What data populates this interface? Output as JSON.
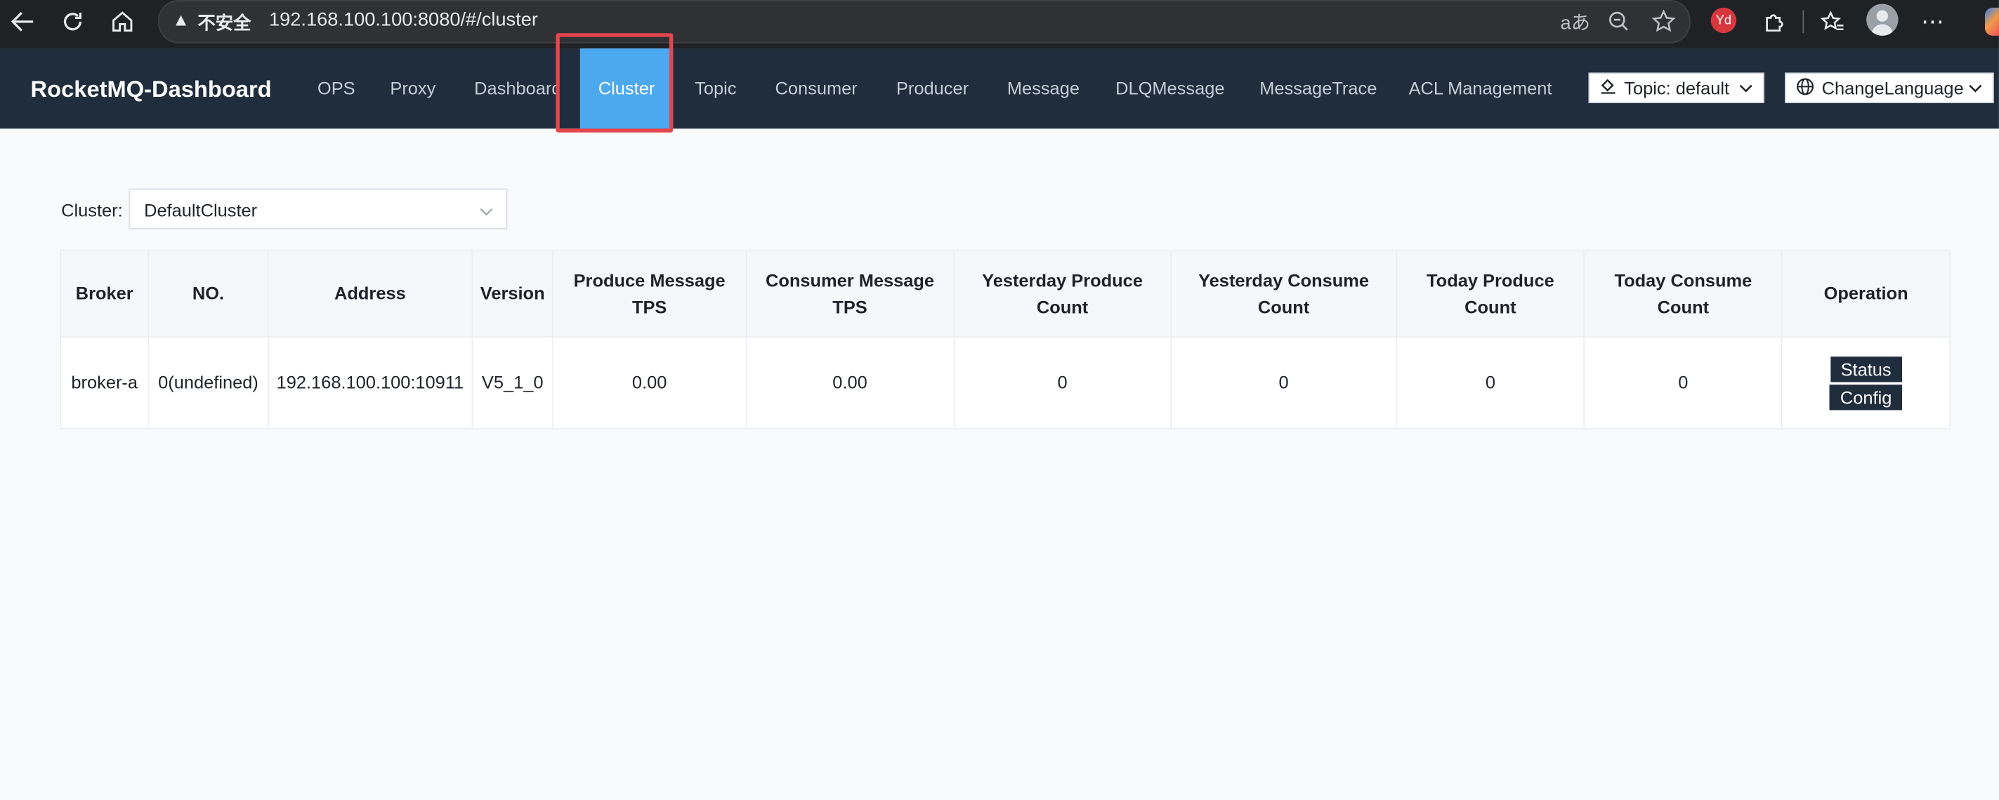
{
  "browser": {
    "security_label": "不安全",
    "url": "192.168.100.100:8080/#/cluster",
    "translate_glyph": "aあ",
    "extension_badge": "Yd"
  },
  "app": {
    "title": "RocketMQ-Dashboard",
    "nav": [
      {
        "label": "OPS",
        "active": false
      },
      {
        "label": "Proxy",
        "active": false
      },
      {
        "label": "Dashboard",
        "active": false
      },
      {
        "label": "Cluster",
        "active": true
      },
      {
        "label": "Topic",
        "active": false
      },
      {
        "label": "Consumer",
        "active": false
      },
      {
        "label": "Producer",
        "active": false
      },
      {
        "label": "Message",
        "active": false
      },
      {
        "label": "DLQMessage",
        "active": false
      },
      {
        "label": "MessageTrace",
        "active": false
      },
      {
        "label": "ACL Management",
        "active": false
      }
    ],
    "theme_select": "Topic: default",
    "language_select": "ChangeLanguage",
    "colors": {
      "header_bg": "#1f2d3d",
      "active_tab": "#4ca9f0",
      "highlight": "#e5454b"
    }
  },
  "filter": {
    "label": "Cluster:",
    "value": "DefaultCluster"
  },
  "table": {
    "headers": [
      "Broker",
      "NO.",
      "Address",
      "Version",
      "Produce Message TPS",
      "Consumer Message TPS",
      "Yesterday Produce Count",
      "Yesterday Consume Count",
      "Today Produce Count",
      "Today Consume Count",
      "Operation"
    ],
    "rows": [
      {
        "broker": "broker-a",
        "no": "0(undefined)",
        "address": "192.168.100.100:10911",
        "version": "V5_1_0",
        "produce_tps": "0.00",
        "consume_tps": "0.00",
        "yesterday_produce": "0",
        "yesterday_consume": "0",
        "today_produce": "0",
        "today_consume": "0",
        "status_label": "Status",
        "config_label": "Config"
      }
    ]
  }
}
